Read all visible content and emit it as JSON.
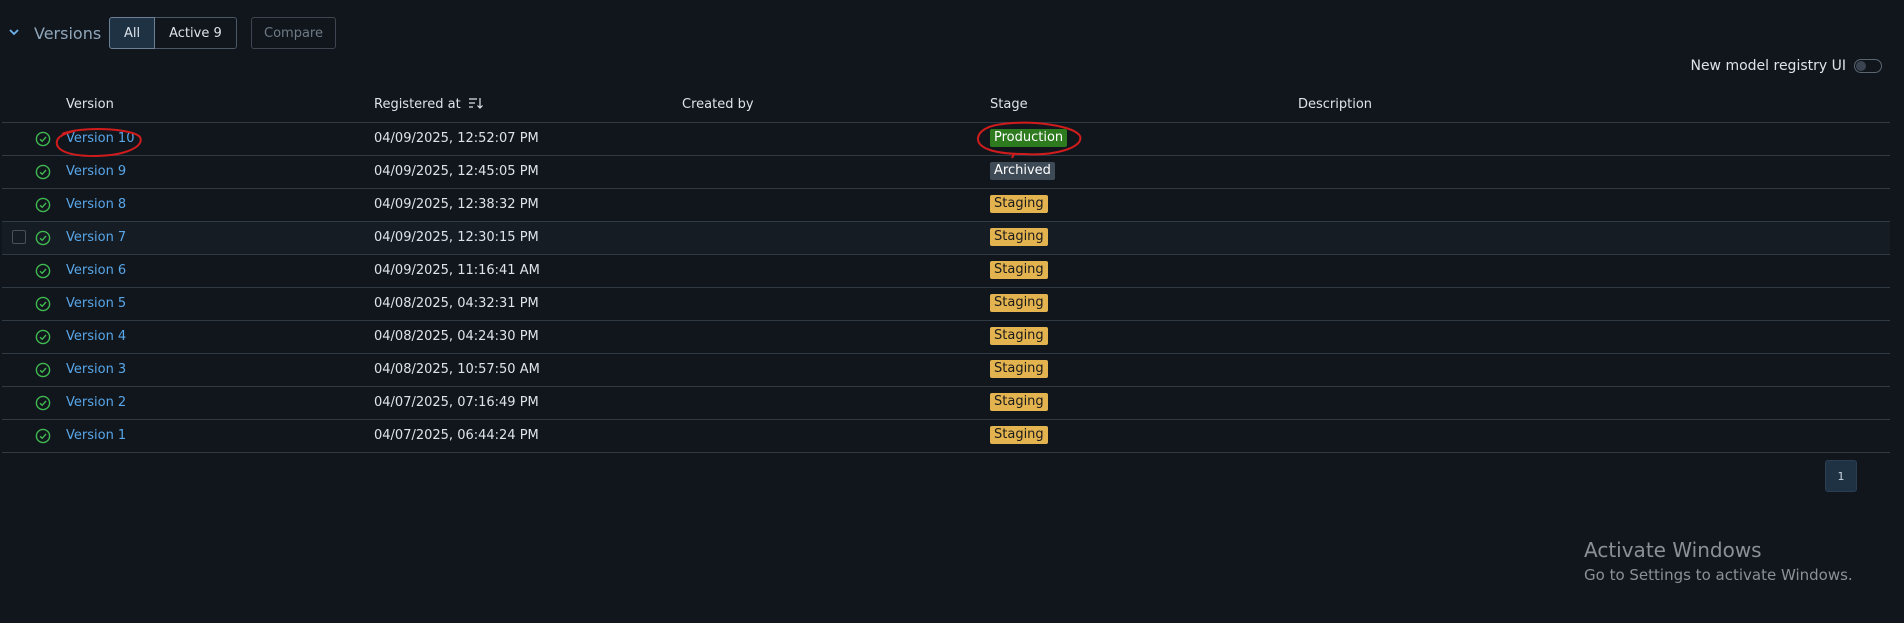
{
  "header": {
    "title": "Versions",
    "filter_all": "All",
    "filter_active": "Active 9",
    "compare": "Compare",
    "toggle_label": "New model registry UI"
  },
  "columns": [
    "Version",
    "Registered at",
    "Created by",
    "Stage",
    "Description"
  ],
  "rows": [
    {
      "version": "Version 10",
      "registered": "04/09/2025, 12:52:07 PM",
      "stage": "Production"
    },
    {
      "version": "Version 9",
      "registered": "04/09/2025, 12:45:05 PM",
      "stage": "Archived"
    },
    {
      "version": "Version 8",
      "registered": "04/09/2025, 12:38:32 PM",
      "stage": "Staging"
    },
    {
      "version": "Version 7",
      "registered": "04/09/2025, 12:30:15 PM",
      "stage": "Staging"
    },
    {
      "version": "Version 6",
      "registered": "04/09/2025, 11:16:41 AM",
      "stage": "Staging"
    },
    {
      "version": "Version 5",
      "registered": "04/08/2025, 04:32:31 PM",
      "stage": "Staging"
    },
    {
      "version": "Version 4",
      "registered": "04/08/2025, 04:24:30 PM",
      "stage": "Staging"
    },
    {
      "version": "Version 3",
      "registered": "04/08/2025, 10:57:50 AM",
      "stage": "Staging"
    },
    {
      "version": "Version 2",
      "registered": "04/07/2025, 07:16:49 PM",
      "stage": "Staging"
    },
    {
      "version": "Version 1",
      "registered": "04/07/2025, 06:44:24 PM",
      "stage": "Staging"
    }
  ],
  "pagination": {
    "current_page": "1"
  },
  "watermark": {
    "title": "Activate Windows",
    "subtitle": "Go to Settings to activate Windows."
  },
  "colors": {
    "production": "#2d7a1f",
    "archived": "#3e4a56",
    "staging": "#e3b34f",
    "link": "#58a6e8",
    "annotation": "#d01c1c"
  },
  "icons": {
    "status": "check-circle-icon",
    "sort": "sort-descending-icon",
    "expand": "chevron-down-icon"
  }
}
